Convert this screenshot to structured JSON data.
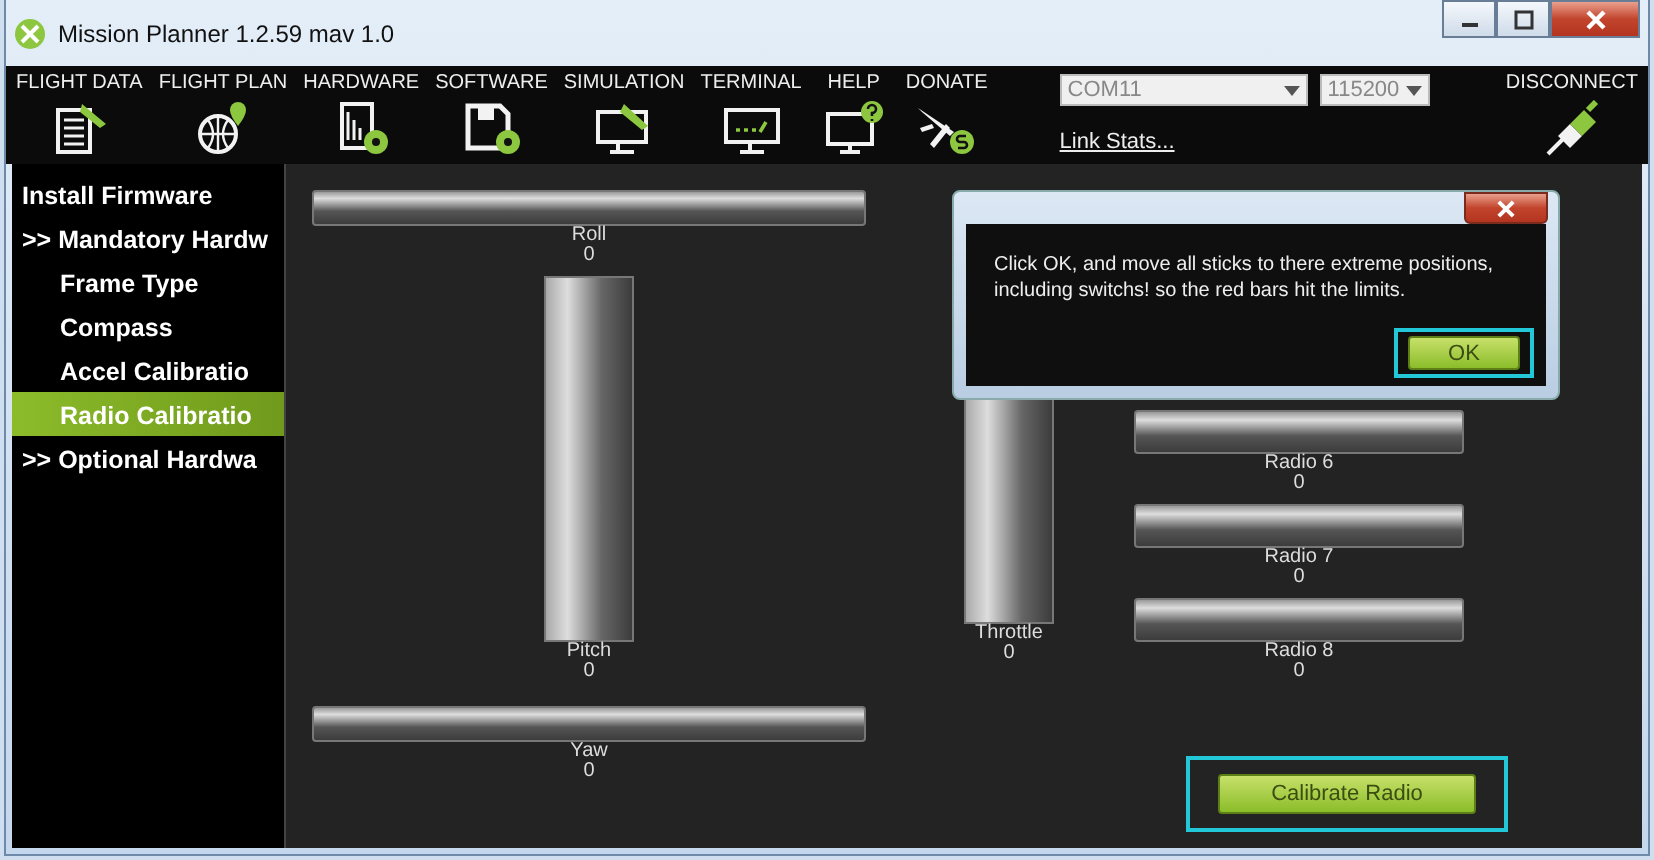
{
  "window": {
    "title": "Mission Planner 1.2.59 mav 1.0"
  },
  "toolbar": {
    "items": [
      {
        "label": "FLIGHT DATA",
        "kind": "flightdata"
      },
      {
        "label": "FLIGHT PLAN",
        "kind": "flightplan"
      },
      {
        "label": "HARDWARE",
        "kind": "hardware"
      },
      {
        "label": "SOFTWARE",
        "kind": "software"
      },
      {
        "label": "SIMULATION",
        "kind": "simulation"
      },
      {
        "label": "TERMINAL",
        "kind": "terminal"
      },
      {
        "label": "HELP",
        "kind": "help"
      },
      {
        "label": "DONATE",
        "kind": "donate"
      }
    ],
    "port": {
      "value": "COM11"
    },
    "baud": {
      "value": "115200"
    },
    "link": "Link Stats...",
    "connect": "DISCONNECT"
  },
  "sidebar": {
    "items": [
      {
        "label": "Install Firmware",
        "kind": "top",
        "selected": false
      },
      {
        "label": ">> Mandatory Hardw",
        "kind": "top",
        "selected": false
      },
      {
        "label": "Frame Type",
        "kind": "sub",
        "selected": false
      },
      {
        "label": "Compass",
        "kind": "sub",
        "selected": false
      },
      {
        "label": "Accel Calibratio",
        "kind": "sub",
        "selected": false
      },
      {
        "label": "Radio Calibratio",
        "kind": "sub",
        "selected": true
      },
      {
        "label": ">> Optional Hardwa",
        "kind": "top",
        "selected": false
      }
    ]
  },
  "channels": [
    {
      "name": "Roll",
      "value": "0",
      "kind": "horizontal"
    },
    {
      "name": "Pitch",
      "value": "0",
      "kind": "vertical"
    },
    {
      "name": "Yaw",
      "value": "0",
      "kind": "horizontal"
    },
    {
      "name": "Throttle",
      "value": "0",
      "kind": "vertical"
    },
    {
      "name": "Radio 6",
      "value": "0",
      "kind": "horizontal"
    },
    {
      "name": "Radio 7",
      "value": "0",
      "kind": "horizontal"
    },
    {
      "name": "Radio 8",
      "value": "0",
      "kind": "horizontal"
    }
  ],
  "calibrate_button": {
    "label": "Calibrate Radio",
    "highlighted": true
  },
  "dialog": {
    "message": "Click OK, and move all sticks to there extreme positions, including switchs! so the red bars hit the limits.",
    "ok_button": {
      "label": "OK",
      "highlighted": true
    }
  }
}
